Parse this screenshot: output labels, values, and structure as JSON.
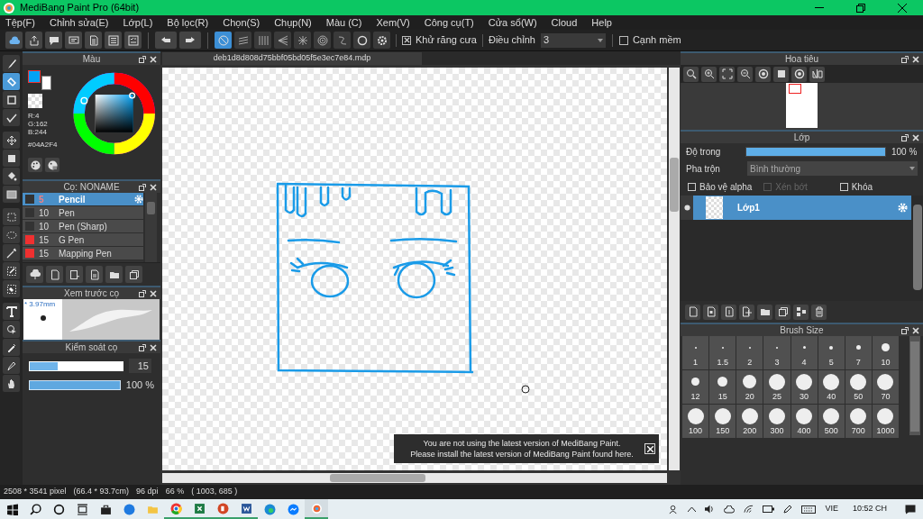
{
  "window": {
    "title": "MediBang Paint Pro (64bit)"
  },
  "menu": [
    "Tệp(F)",
    "Chỉnh sửa(E)",
    "Lớp(L)",
    "Bộ lọc(R)",
    "Chọn(S)",
    "Chụp(N)",
    "Màu (C)",
    "Xem(V)",
    "Công cụ(T)",
    "Cửa sổ(W)",
    "Cloud",
    "Help"
  ],
  "toolbar": {
    "snap_buttons": [
      {
        "selected": true
      },
      {
        "selected": false
      },
      {
        "selected": false
      },
      {
        "selected": false
      },
      {
        "selected": false
      },
      {
        "selected": false
      },
      {
        "selected": false
      },
      {
        "selected": false
      },
      {
        "selected": false
      }
    ],
    "antialias": {
      "label": "Khử răng cưa",
      "checked": true
    },
    "adjust": {
      "label": "Điều chỉnh",
      "value": "3"
    },
    "soft_edge": {
      "label": "Cạnh mềm",
      "checked": false
    }
  },
  "tools": [
    {
      "selected": false
    },
    {
      "selected": true
    },
    {
      "selected": false
    },
    {
      "selected": false
    },
    {
      "selected": false
    },
    {
      "selected": false
    },
    {
      "selected": false
    },
    {
      "selected": false
    },
    {
      "selected": false
    },
    {
      "selected": false
    },
    {
      "selected": false
    },
    {
      "selected": false
    },
    {
      "selected": false
    },
    {
      "selected": false
    },
    {
      "selected": false
    },
    {
      "selected": false
    },
    {
      "selected": false
    },
    {
      "selected": false
    }
  ],
  "color_panel": {
    "title": "Màu",
    "color": "#04a2f4",
    "rgb": [
      "R:4",
      "G:162",
      "B:244"
    ],
    "hex": "#04A2F4"
  },
  "brush_panel": {
    "title": "Cọ: NONAME",
    "brushes": [
      {
        "size": "5",
        "name": "Pencil",
        "color": "#333333",
        "selected": true
      },
      {
        "size": "10",
        "name": "Pen",
        "color": "#333333",
        "selected": false
      },
      {
        "size": "10",
        "name": "Pen (Sharp)",
        "color": "#333333",
        "selected": false
      },
      {
        "size": "15",
        "name": "G Pen",
        "color": "#f03030",
        "selected": false
      },
      {
        "size": "15",
        "name": "Mapping Pen",
        "color": "#f03030",
        "selected": false
      }
    ]
  },
  "brush_preview": {
    "title": "Xem trước cọ",
    "size": "* 3.97mm"
  },
  "brush_control": {
    "title": "Kiểm soát cọ",
    "width": {
      "level": 0.3,
      "value": "15"
    },
    "opacity": {
      "level": 1,
      "value": "100 %"
    }
  },
  "document_tab": "deb1d8d808d75bbf05bd05f5e3ec7e84.mdp",
  "notification": [
    "You are not using the latest version of MediBang Paint.",
    "Please install the latest version of MediBang Paint found here."
  ],
  "navigator": {
    "title": "Hoa tiêu"
  },
  "layer_panel": {
    "title": "Lớp",
    "opacity": {
      "label": "Độ trong",
      "level": 1,
      "reading": "100 %"
    },
    "blend": {
      "label": "Pha trộn",
      "value": "Bình thường"
    },
    "options": [
      {
        "label": "Bảo vệ alpha",
        "checked": false,
        "disabled": false
      },
      {
        "label": "Xén bớt",
        "checked": false,
        "disabled": true
      },
      {
        "label": "Khóa",
        "checked": false,
        "disabled": false
      }
    ],
    "layers": [
      {
        "name": "Lớp1",
        "selected": true,
        "visible": true
      }
    ]
  },
  "brush_size": {
    "title": "Brush Size",
    "sizes": [
      "1",
      "1.5",
      "2",
      "3",
      "4",
      "5",
      "7",
      "10",
      "12",
      "15",
      "20",
      "25",
      "30",
      "40",
      "50",
      "70",
      "100",
      "150",
      "200",
      "300",
      "400",
      "500",
      "700",
      "1000"
    ]
  },
  "status_bar": [
    "2508 * 3541 pixel",
    "(66.4 * 93.7cm)",
    "96 dpi",
    "66 %",
    "( 1003, 685 )"
  ],
  "taskbar": {
    "language": "VIE",
    "time": "10:52 CH"
  }
}
